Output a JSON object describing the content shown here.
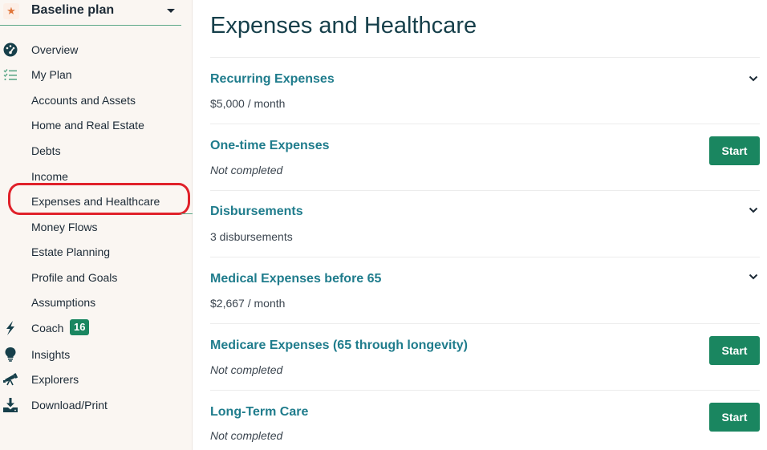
{
  "sidebar": {
    "plan_name": "Baseline plan",
    "plan_icon": "star-icon",
    "items": [
      {
        "label": "Overview",
        "icon": "dashboard-gauge-icon",
        "level": 0
      },
      {
        "label": "My Plan",
        "icon": "checklist-icon",
        "level": 0
      },
      {
        "label": "Accounts and Assets",
        "level": 1
      },
      {
        "label": "Home and Real Estate",
        "level": 1
      },
      {
        "label": "Debts",
        "level": 1
      },
      {
        "label": "Income",
        "level": 1
      },
      {
        "label": "Expenses and Healthcare",
        "level": 1,
        "active": true
      },
      {
        "label": "Money Flows",
        "level": 1
      },
      {
        "label": "Estate Planning",
        "level": 1
      },
      {
        "label": "Profile and Goals",
        "level": 1
      },
      {
        "label": "Assumptions",
        "level": 1
      },
      {
        "label": "Coach",
        "icon": "lightning-bolt-icon",
        "level": 0,
        "badge": "16"
      },
      {
        "label": "Insights",
        "icon": "lightbulb-icon",
        "level": 0
      },
      {
        "label": "Explorers",
        "icon": "telescope-icon",
        "level": 0
      },
      {
        "label": "Download/Print",
        "icon": "download-icon",
        "level": 0
      }
    ]
  },
  "main": {
    "title": "Expenses and Healthcare",
    "sections": [
      {
        "title": "Recurring Expenses",
        "subtitle": "$5,000 / month",
        "action": "expand"
      },
      {
        "title": "One-time Expenses",
        "subtitle": "Not completed",
        "action": "start",
        "button_label": "Start"
      },
      {
        "title": "Disbursements",
        "subtitle": "3 disbursements",
        "action": "expand"
      },
      {
        "title": "Medical Expenses before 65",
        "subtitle": "$2,667 / month",
        "action": "expand"
      },
      {
        "title": "Medicare Expenses (65 through longevity)",
        "subtitle": "Not completed",
        "action": "start",
        "button_label": "Start"
      },
      {
        "title": "Long-Term Care",
        "subtitle": "Not completed",
        "action": "start",
        "button_label": "Start"
      }
    ]
  },
  "colors": {
    "accent_green": "#1a8660",
    "link_teal": "#1f7c8c",
    "title_dark": "#163f4a",
    "highlight_red": "#e0212a",
    "sidebar_bg": "#faf6f2",
    "star_orange": "#e0763a"
  }
}
